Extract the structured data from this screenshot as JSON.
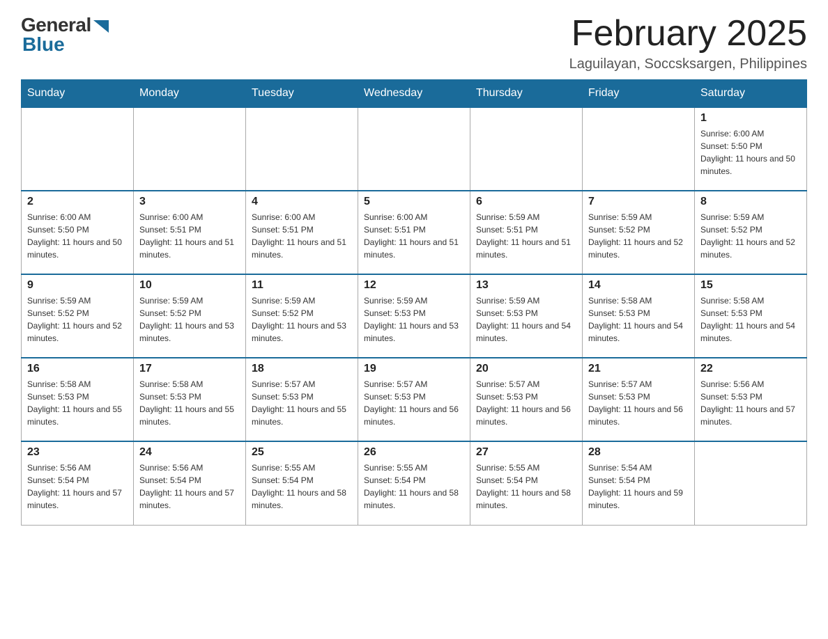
{
  "logo": {
    "general": "General",
    "arrow": "▶",
    "blue": "Blue"
  },
  "header": {
    "month_year": "February 2025",
    "location": "Laguilayan, Soccsksargen, Philippines"
  },
  "days_of_week": [
    "Sunday",
    "Monday",
    "Tuesday",
    "Wednesday",
    "Thursday",
    "Friday",
    "Saturday"
  ],
  "weeks": [
    [
      {
        "day": "",
        "sunrise": "",
        "sunset": "",
        "daylight": ""
      },
      {
        "day": "",
        "sunrise": "",
        "sunset": "",
        "daylight": ""
      },
      {
        "day": "",
        "sunrise": "",
        "sunset": "",
        "daylight": ""
      },
      {
        "day": "",
        "sunrise": "",
        "sunset": "",
        "daylight": ""
      },
      {
        "day": "",
        "sunrise": "",
        "sunset": "",
        "daylight": ""
      },
      {
        "day": "",
        "sunrise": "",
        "sunset": "",
        "daylight": ""
      },
      {
        "day": "1",
        "sunrise": "Sunrise: 6:00 AM",
        "sunset": "Sunset: 5:50 PM",
        "daylight": "Daylight: 11 hours and 50 minutes."
      }
    ],
    [
      {
        "day": "2",
        "sunrise": "Sunrise: 6:00 AM",
        "sunset": "Sunset: 5:50 PM",
        "daylight": "Daylight: 11 hours and 50 minutes."
      },
      {
        "day": "3",
        "sunrise": "Sunrise: 6:00 AM",
        "sunset": "Sunset: 5:51 PM",
        "daylight": "Daylight: 11 hours and 51 minutes."
      },
      {
        "day": "4",
        "sunrise": "Sunrise: 6:00 AM",
        "sunset": "Sunset: 5:51 PM",
        "daylight": "Daylight: 11 hours and 51 minutes."
      },
      {
        "day": "5",
        "sunrise": "Sunrise: 6:00 AM",
        "sunset": "Sunset: 5:51 PM",
        "daylight": "Daylight: 11 hours and 51 minutes."
      },
      {
        "day": "6",
        "sunrise": "Sunrise: 5:59 AM",
        "sunset": "Sunset: 5:51 PM",
        "daylight": "Daylight: 11 hours and 51 minutes."
      },
      {
        "day": "7",
        "sunrise": "Sunrise: 5:59 AM",
        "sunset": "Sunset: 5:52 PM",
        "daylight": "Daylight: 11 hours and 52 minutes."
      },
      {
        "day": "8",
        "sunrise": "Sunrise: 5:59 AM",
        "sunset": "Sunset: 5:52 PM",
        "daylight": "Daylight: 11 hours and 52 minutes."
      }
    ],
    [
      {
        "day": "9",
        "sunrise": "Sunrise: 5:59 AM",
        "sunset": "Sunset: 5:52 PM",
        "daylight": "Daylight: 11 hours and 52 minutes."
      },
      {
        "day": "10",
        "sunrise": "Sunrise: 5:59 AM",
        "sunset": "Sunset: 5:52 PM",
        "daylight": "Daylight: 11 hours and 53 minutes."
      },
      {
        "day": "11",
        "sunrise": "Sunrise: 5:59 AM",
        "sunset": "Sunset: 5:52 PM",
        "daylight": "Daylight: 11 hours and 53 minutes."
      },
      {
        "day": "12",
        "sunrise": "Sunrise: 5:59 AM",
        "sunset": "Sunset: 5:53 PM",
        "daylight": "Daylight: 11 hours and 53 minutes."
      },
      {
        "day": "13",
        "sunrise": "Sunrise: 5:59 AM",
        "sunset": "Sunset: 5:53 PM",
        "daylight": "Daylight: 11 hours and 54 minutes."
      },
      {
        "day": "14",
        "sunrise": "Sunrise: 5:58 AM",
        "sunset": "Sunset: 5:53 PM",
        "daylight": "Daylight: 11 hours and 54 minutes."
      },
      {
        "day": "15",
        "sunrise": "Sunrise: 5:58 AM",
        "sunset": "Sunset: 5:53 PM",
        "daylight": "Daylight: 11 hours and 54 minutes."
      }
    ],
    [
      {
        "day": "16",
        "sunrise": "Sunrise: 5:58 AM",
        "sunset": "Sunset: 5:53 PM",
        "daylight": "Daylight: 11 hours and 55 minutes."
      },
      {
        "day": "17",
        "sunrise": "Sunrise: 5:58 AM",
        "sunset": "Sunset: 5:53 PM",
        "daylight": "Daylight: 11 hours and 55 minutes."
      },
      {
        "day": "18",
        "sunrise": "Sunrise: 5:57 AM",
        "sunset": "Sunset: 5:53 PM",
        "daylight": "Daylight: 11 hours and 55 minutes."
      },
      {
        "day": "19",
        "sunrise": "Sunrise: 5:57 AM",
        "sunset": "Sunset: 5:53 PM",
        "daylight": "Daylight: 11 hours and 56 minutes."
      },
      {
        "day": "20",
        "sunrise": "Sunrise: 5:57 AM",
        "sunset": "Sunset: 5:53 PM",
        "daylight": "Daylight: 11 hours and 56 minutes."
      },
      {
        "day": "21",
        "sunrise": "Sunrise: 5:57 AM",
        "sunset": "Sunset: 5:53 PM",
        "daylight": "Daylight: 11 hours and 56 minutes."
      },
      {
        "day": "22",
        "sunrise": "Sunrise: 5:56 AM",
        "sunset": "Sunset: 5:53 PM",
        "daylight": "Daylight: 11 hours and 57 minutes."
      }
    ],
    [
      {
        "day": "23",
        "sunrise": "Sunrise: 5:56 AM",
        "sunset": "Sunset: 5:54 PM",
        "daylight": "Daylight: 11 hours and 57 minutes."
      },
      {
        "day": "24",
        "sunrise": "Sunrise: 5:56 AM",
        "sunset": "Sunset: 5:54 PM",
        "daylight": "Daylight: 11 hours and 57 minutes."
      },
      {
        "day": "25",
        "sunrise": "Sunrise: 5:55 AM",
        "sunset": "Sunset: 5:54 PM",
        "daylight": "Daylight: 11 hours and 58 minutes."
      },
      {
        "day": "26",
        "sunrise": "Sunrise: 5:55 AM",
        "sunset": "Sunset: 5:54 PM",
        "daylight": "Daylight: 11 hours and 58 minutes."
      },
      {
        "day": "27",
        "sunrise": "Sunrise: 5:55 AM",
        "sunset": "Sunset: 5:54 PM",
        "daylight": "Daylight: 11 hours and 58 minutes."
      },
      {
        "day": "28",
        "sunrise": "Sunrise: 5:54 AM",
        "sunset": "Sunset: 5:54 PM",
        "daylight": "Daylight: 11 hours and 59 minutes."
      },
      {
        "day": "",
        "sunrise": "",
        "sunset": "",
        "daylight": ""
      }
    ]
  ]
}
